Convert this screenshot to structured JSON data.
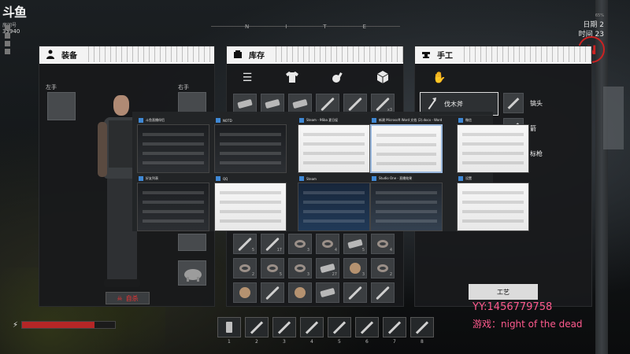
{
  "stream": {
    "logo": "斗鱼",
    "sub": "房间号",
    "room": "33940"
  },
  "top_right": {
    "percent": "65%",
    "day_label": "日期 2",
    "time_label": "时间 23"
  },
  "compass": {
    "letter": "N"
  },
  "top_center": {
    "marks": [
      "N",
      "I",
      "T",
      "E"
    ]
  },
  "equipment": {
    "title": "装备",
    "left_hand": "左手",
    "right_hand": "右手",
    "suicide_button": "自杀"
  },
  "inventory": {
    "title": "库存",
    "tabs": [
      "list-icon",
      "shirt-icon",
      "meat-icon",
      "box-icon"
    ],
    "row1": [
      {
        "type": "brick",
        "qty": ""
      },
      {
        "type": "brick",
        "qty": ""
      },
      {
        "type": "brick",
        "qty": ""
      },
      {
        "type": "stick",
        "qty": ""
      },
      {
        "type": "stick",
        "qty": ""
      },
      {
        "type": "stick",
        "qty": "x3"
      }
    ],
    "rows_bottom": [
      [
        {
          "type": "stick",
          "qty": "5"
        },
        {
          "type": "stick",
          "qty": "17"
        },
        {
          "type": "ring",
          "qty": "3"
        },
        {
          "type": "ring",
          "qty": "4"
        },
        {
          "type": "brick",
          "qty": "5"
        },
        {
          "type": "ring",
          "qty": "4"
        }
      ],
      [
        {
          "type": "ring",
          "qty": "2"
        },
        {
          "type": "ring",
          "qty": "5"
        },
        {
          "type": "ring",
          "qty": "3"
        },
        {
          "type": "brick",
          "qty": "27"
        },
        {
          "type": "blob",
          "qty": "3"
        },
        {
          "type": "ring",
          "qty": "2"
        }
      ],
      [
        {
          "type": "blob",
          "qty": ""
        },
        {
          "type": "stick",
          "qty": ""
        },
        {
          "type": "blob",
          "qty": ""
        },
        {
          "type": "brick",
          "qty": ""
        },
        {
          "type": "stick",
          "qty": ""
        },
        {
          "type": "stick",
          "qty": ""
        }
      ]
    ]
  },
  "crafting": {
    "title": "手工",
    "selected": "伐木斧",
    "recipes": [
      "镐头",
      "箭",
      "标枪"
    ],
    "craft_button": "工艺"
  },
  "switcher": {
    "windows": [
      {
        "title": "斗鱼直播伴侣",
        "theme": "dark"
      },
      {
        "title": "NOTD",
        "theme": "dark"
      },
      {
        "title": "Steam - 96ba 夏日促",
        "theme": "light"
      },
      {
        "title": "新建 Microsoft Word 文档 (2).docx - Word",
        "theme": "light",
        "selected": true
      },
      {
        "title": "微信",
        "theme": "light"
      },
      {
        "title": "好友列表",
        "theme": "dark"
      },
      {
        "title": "QQ",
        "theme": "light"
      },
      {
        "title": "Steam",
        "theme": "blue"
      },
      {
        "title": "Studio One - 直播效果",
        "theme": "studio"
      },
      {
        "title": "设置",
        "theme": "light"
      }
    ]
  },
  "hotbar": {
    "slots": [
      "1",
      "2",
      "3",
      "4",
      "5",
      "6",
      "7",
      "8"
    ]
  },
  "health": {
    "level": 0.78
  },
  "overlay": {
    "yy": "YY:1456779758",
    "game": "游戏：night  of the dead"
  },
  "colors": {
    "panel_header": "#f3f3f3",
    "accent_red": "#cc2222",
    "overlay_pink": "#ff5a8e"
  }
}
